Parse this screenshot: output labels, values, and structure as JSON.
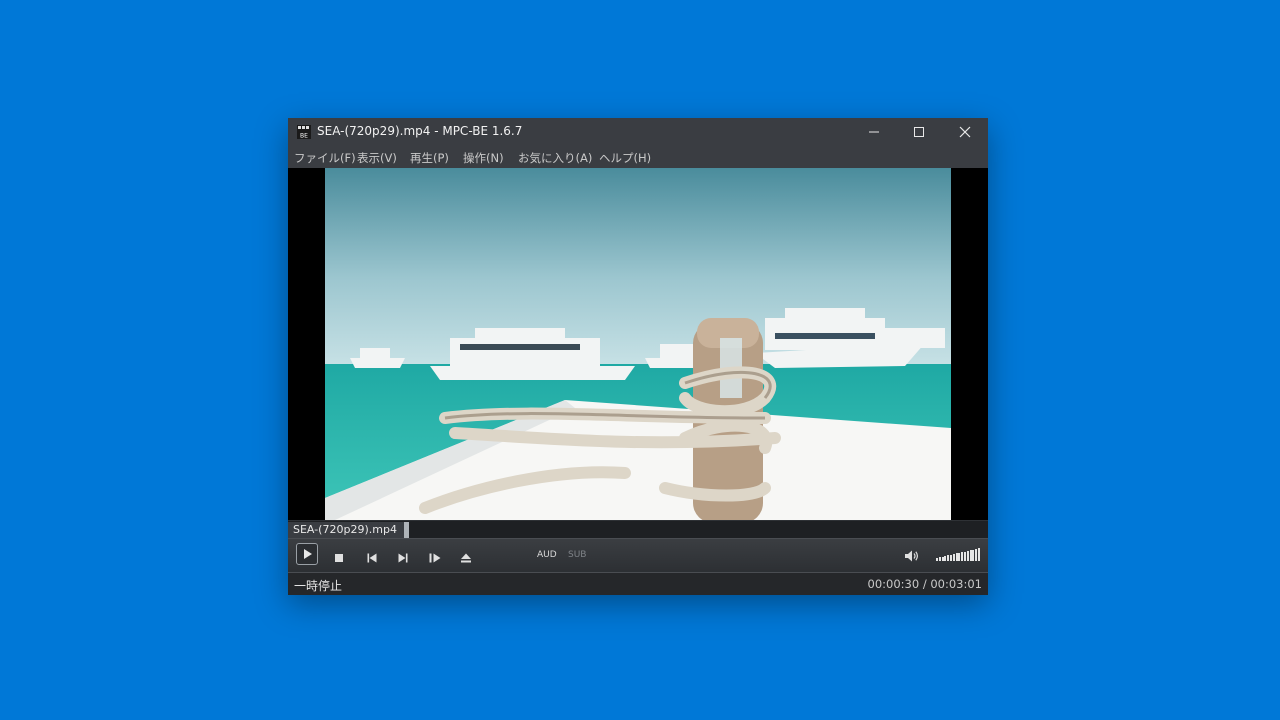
{
  "window": {
    "title": "SEA-(720p29).mp4 - MPC-BE 1.6.7",
    "app_icon_text": "BE"
  },
  "menu": [
    {
      "label": "ファイル(F)"
    },
    {
      "label": "表示(V)"
    },
    {
      "label": "再生(P)"
    },
    {
      "label": "操作(N)"
    },
    {
      "label": "お気に入り(A)"
    },
    {
      "label": "ヘルプ(H)"
    }
  ],
  "seekbar": {
    "file_label": "SEA-(720p29).mp4",
    "progress": 0.166
  },
  "controls": {
    "audio_label": "AUD",
    "subtitle_label": "SUB",
    "volume_level": 1.0
  },
  "status": {
    "state": "一時停止",
    "time": "00:00:30 / 00:03:01"
  },
  "colors": {
    "desktop": "#0078d7",
    "titlebar": "#3a3d42",
    "accent_text": "#e6e6e6"
  },
  "icons": {
    "app": "mpc-be-icon",
    "minimize": "minimize-icon",
    "maximize": "maximize-icon",
    "close": "close-icon",
    "play": "play-icon",
    "stop": "stop-icon",
    "previous": "skip-previous-icon",
    "next": "skip-next-icon",
    "frame_step": "frame-step-icon",
    "eject": "eject-icon",
    "volume": "speaker-icon"
  }
}
